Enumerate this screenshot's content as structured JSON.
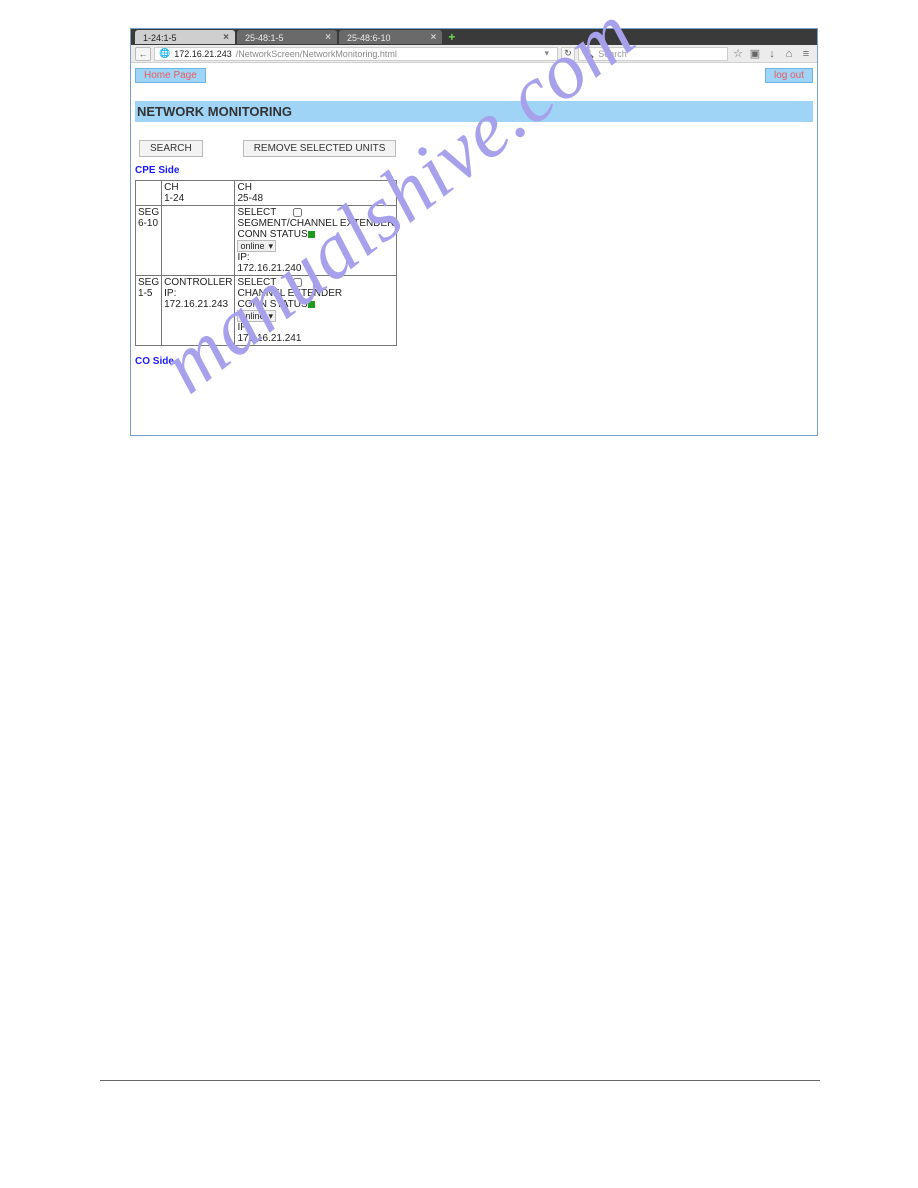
{
  "watermark": "manualshive.com",
  "browser": {
    "tabs": [
      {
        "label": "1-24:1-5",
        "active": true
      },
      {
        "label": "25-48:1-5",
        "active": false
      },
      {
        "label": "25-48:6-10",
        "active": false
      }
    ],
    "url_host": "172.16.21.243",
    "url_path": "/NetworkScreen/NetworkMonitoring.html",
    "search_placeholder": "Search"
  },
  "nav": {
    "home": "Home Page",
    "logout": "log out"
  },
  "page": {
    "title": "NETWORK MONITORING"
  },
  "actions": {
    "search": "SEARCH",
    "remove": "REMOVE SELECTED UNITS"
  },
  "sections": {
    "cpe": "CPE Side",
    "co": "CO Side"
  },
  "table": {
    "col1_header_line1": "CH",
    "col1_header_line2": "1-24",
    "col2_header_line1": "CH",
    "col2_header_line2": "25-48",
    "row1": {
      "seg_label": "SEG",
      "seg_range": "6-10",
      "mid": "",
      "select_label": "SELECT",
      "type": "SEGMENT/CHANNEL EXTENDER",
      "conn_label": "CONN STATUS",
      "online": "online",
      "ip_label": "IP:",
      "ip_value": "172.16.21.240"
    },
    "row2": {
      "seg_label": "SEG",
      "seg_range": "1-5",
      "mid_line1": "CONTROLLER",
      "mid_line2": "IP:",
      "mid_line3": "172.16.21.243",
      "select_label": "SELECT",
      "type": "CHANNEL EXTENDER",
      "conn_label": "CONN STATUS",
      "online": "online",
      "ip_label": "IP:",
      "ip_value": "172.16.21.241"
    }
  }
}
